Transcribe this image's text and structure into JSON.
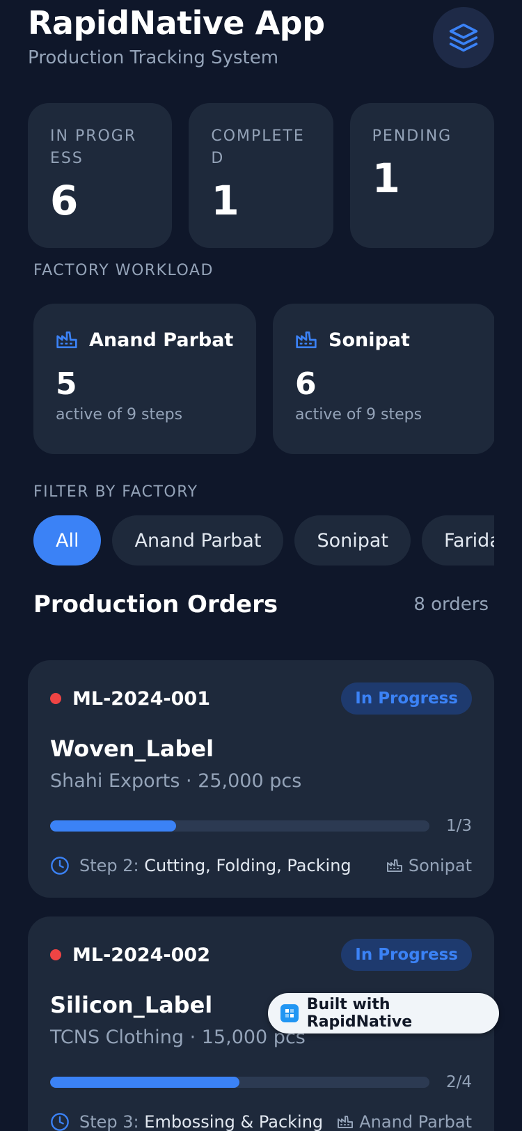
{
  "header": {
    "title": "RapidNative App",
    "subtitle": "Production Tracking System",
    "action_icon": "layers-icon"
  },
  "stats": [
    {
      "label": "IN PROGRESS",
      "value": "6"
    },
    {
      "label": "COMPLETED",
      "value": "1"
    },
    {
      "label": "PENDING",
      "value": "1"
    }
  ],
  "workload": {
    "section_label": "FACTORY WORKLOAD",
    "factories": [
      {
        "name": "Anand Parbat",
        "count": "5",
        "sub": "active of 9 steps"
      },
      {
        "name": "Sonipat",
        "count": "6",
        "sub": "active of 9 steps"
      }
    ]
  },
  "filter": {
    "section_label": "FILTER BY FACTORY",
    "chips": [
      "All",
      "Anand Parbat",
      "Sonipat",
      "Faridabad"
    ],
    "active": "All"
  },
  "orders": {
    "title": "Production Orders",
    "count_label": "8 orders",
    "items": [
      {
        "id": "ML-2024-001",
        "status": "In Progress",
        "product": "Woven_Label",
        "meta": "Shahi Exports · 25,000 pcs",
        "progress": 0.333,
        "fraction": "1/3",
        "step_prefix": "Step 2:",
        "step_name": "Cutting, Folding, Packing",
        "factory": "Sonipat"
      },
      {
        "id": "ML-2024-002",
        "status": "In Progress",
        "product": "Silicon_Label",
        "meta": "TCNS Clothing · 15,000 pcs",
        "progress": 0.5,
        "fraction": "2/4",
        "step_prefix": "Step 3:",
        "step_name": "Embossing & Packing",
        "factory": "Anand Parbat"
      }
    ]
  },
  "built_badge": {
    "label": "Built with RapidNative"
  },
  "colors": {
    "background": "#0f172a",
    "card": "#1e293b",
    "accent": "#3b82f6",
    "status_dot": "#ef4444"
  }
}
